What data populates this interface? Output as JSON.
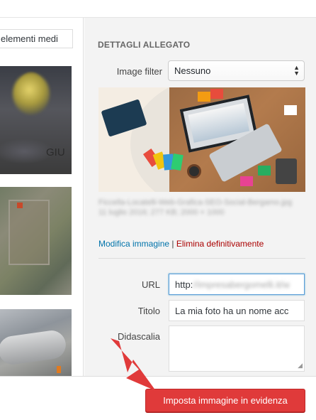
{
  "toolbar": {
    "search_placeholder": "elementi medi"
  },
  "media_grid": {
    "items": [
      {
        "overlay_text": "GIU"
      },
      {
        "overlay_text": ""
      },
      {
        "overlay_text": ""
      }
    ]
  },
  "details": {
    "heading": "DETTAGLI ALLEGATO",
    "image_filter": {
      "label": "Image filter",
      "selected": "Nessuno"
    },
    "file": {
      "filename": "Ficcella-Locatelli-Web-Grafica-SEO-Social-Bergamo.jpg",
      "info": "11 luglio 2016; 277 KB; 2000 × 1000"
    },
    "links": {
      "edit": "Modifica immagine",
      "separator": "|",
      "delete": "Elimina definitivamente"
    },
    "fields": {
      "url_label": "URL",
      "url_prefix": "http:",
      "url_rest": "//impresabergomelli.it/w",
      "title_label": "Titolo",
      "title_value": "La mia foto ha un nome acc",
      "caption_label": "Didascalia",
      "caption_value": ""
    }
  },
  "footer": {
    "primary_button": "Imposta immagine in evidenza"
  },
  "colors": {
    "accent_red": "#e03a3a",
    "link_blue": "#0073aa",
    "delete_red": "#aa0000",
    "panel_bg": "#f3f3f3"
  }
}
